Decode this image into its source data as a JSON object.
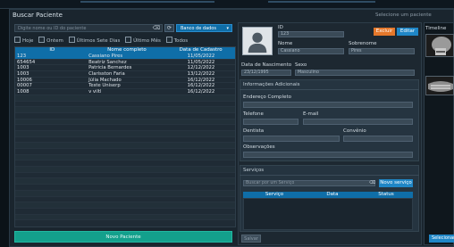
{
  "window": {
    "title": "Buscar Paciente",
    "right_title": "Selecione um paciente"
  },
  "search": {
    "placeholder": "Digite nome ou ID do paciente",
    "source_select": "Banco de dados"
  },
  "filters": [
    "Hoje",
    "Ontem",
    "Últimos Sete Dias",
    "Último Mês",
    "Todos"
  ],
  "table": {
    "headers": [
      "ID",
      "Nome completo",
      "Data de Cadastro"
    ],
    "rows": [
      {
        "id": "123",
        "name": "Cassiano Pires",
        "date": "11/05/2022"
      },
      {
        "id": "654654",
        "name": "Beatriz Sanchez",
        "date": "11/05/2022"
      },
      {
        "id": "1003",
        "name": "Patrícia Bernardes",
        "date": "12/12/2022"
      },
      {
        "id": "1003",
        "name": "Clarisston Faria",
        "date": "13/12/2022"
      },
      {
        "id": "10006",
        "name": "Júlia Machado",
        "date": "16/12/2022"
      },
      {
        "id": "00007",
        "name": "Teste Uniserp",
        "date": "16/12/2022"
      },
      {
        "id": "1008",
        "name": "v viltl",
        "date": "16/12/2022"
      }
    ],
    "empty_row_count": 21
  },
  "buttons": {
    "new_patient": "Novo Paciente",
    "delete": "Excluir",
    "edit": "Editar",
    "save": "Salvar",
    "new_service": "Novo serviço",
    "select": "Selecionar"
  },
  "patient": {
    "id_label": "ID",
    "id_value": "123",
    "name_label": "Nome",
    "name_value": "Cassiano",
    "surname_label": "Sobrenome",
    "surname_value": "Pires",
    "birth_label": "Data de Nascimento",
    "birth_value": "23/12/1995",
    "sex_label": "Sexo",
    "sex_value": "Masculino"
  },
  "additional": {
    "title": "Informações Adicionais",
    "address_label": "Endereço Completo",
    "phone_label": "Telefone",
    "email_label": "E-mail",
    "dentist_label": "Dentista",
    "insurance_label": "Convênio",
    "notes_label": "Observações"
  },
  "services": {
    "title": "Serviços",
    "search_placeholder": "Buscar por um Serviço",
    "headers": [
      "Serviço",
      "Data",
      "Status"
    ]
  },
  "timeline": {
    "title": "Timeline"
  },
  "colors": {
    "accent_blue": "#0f6ea8",
    "teal": "#13a08c",
    "orange": "#e5782b"
  }
}
